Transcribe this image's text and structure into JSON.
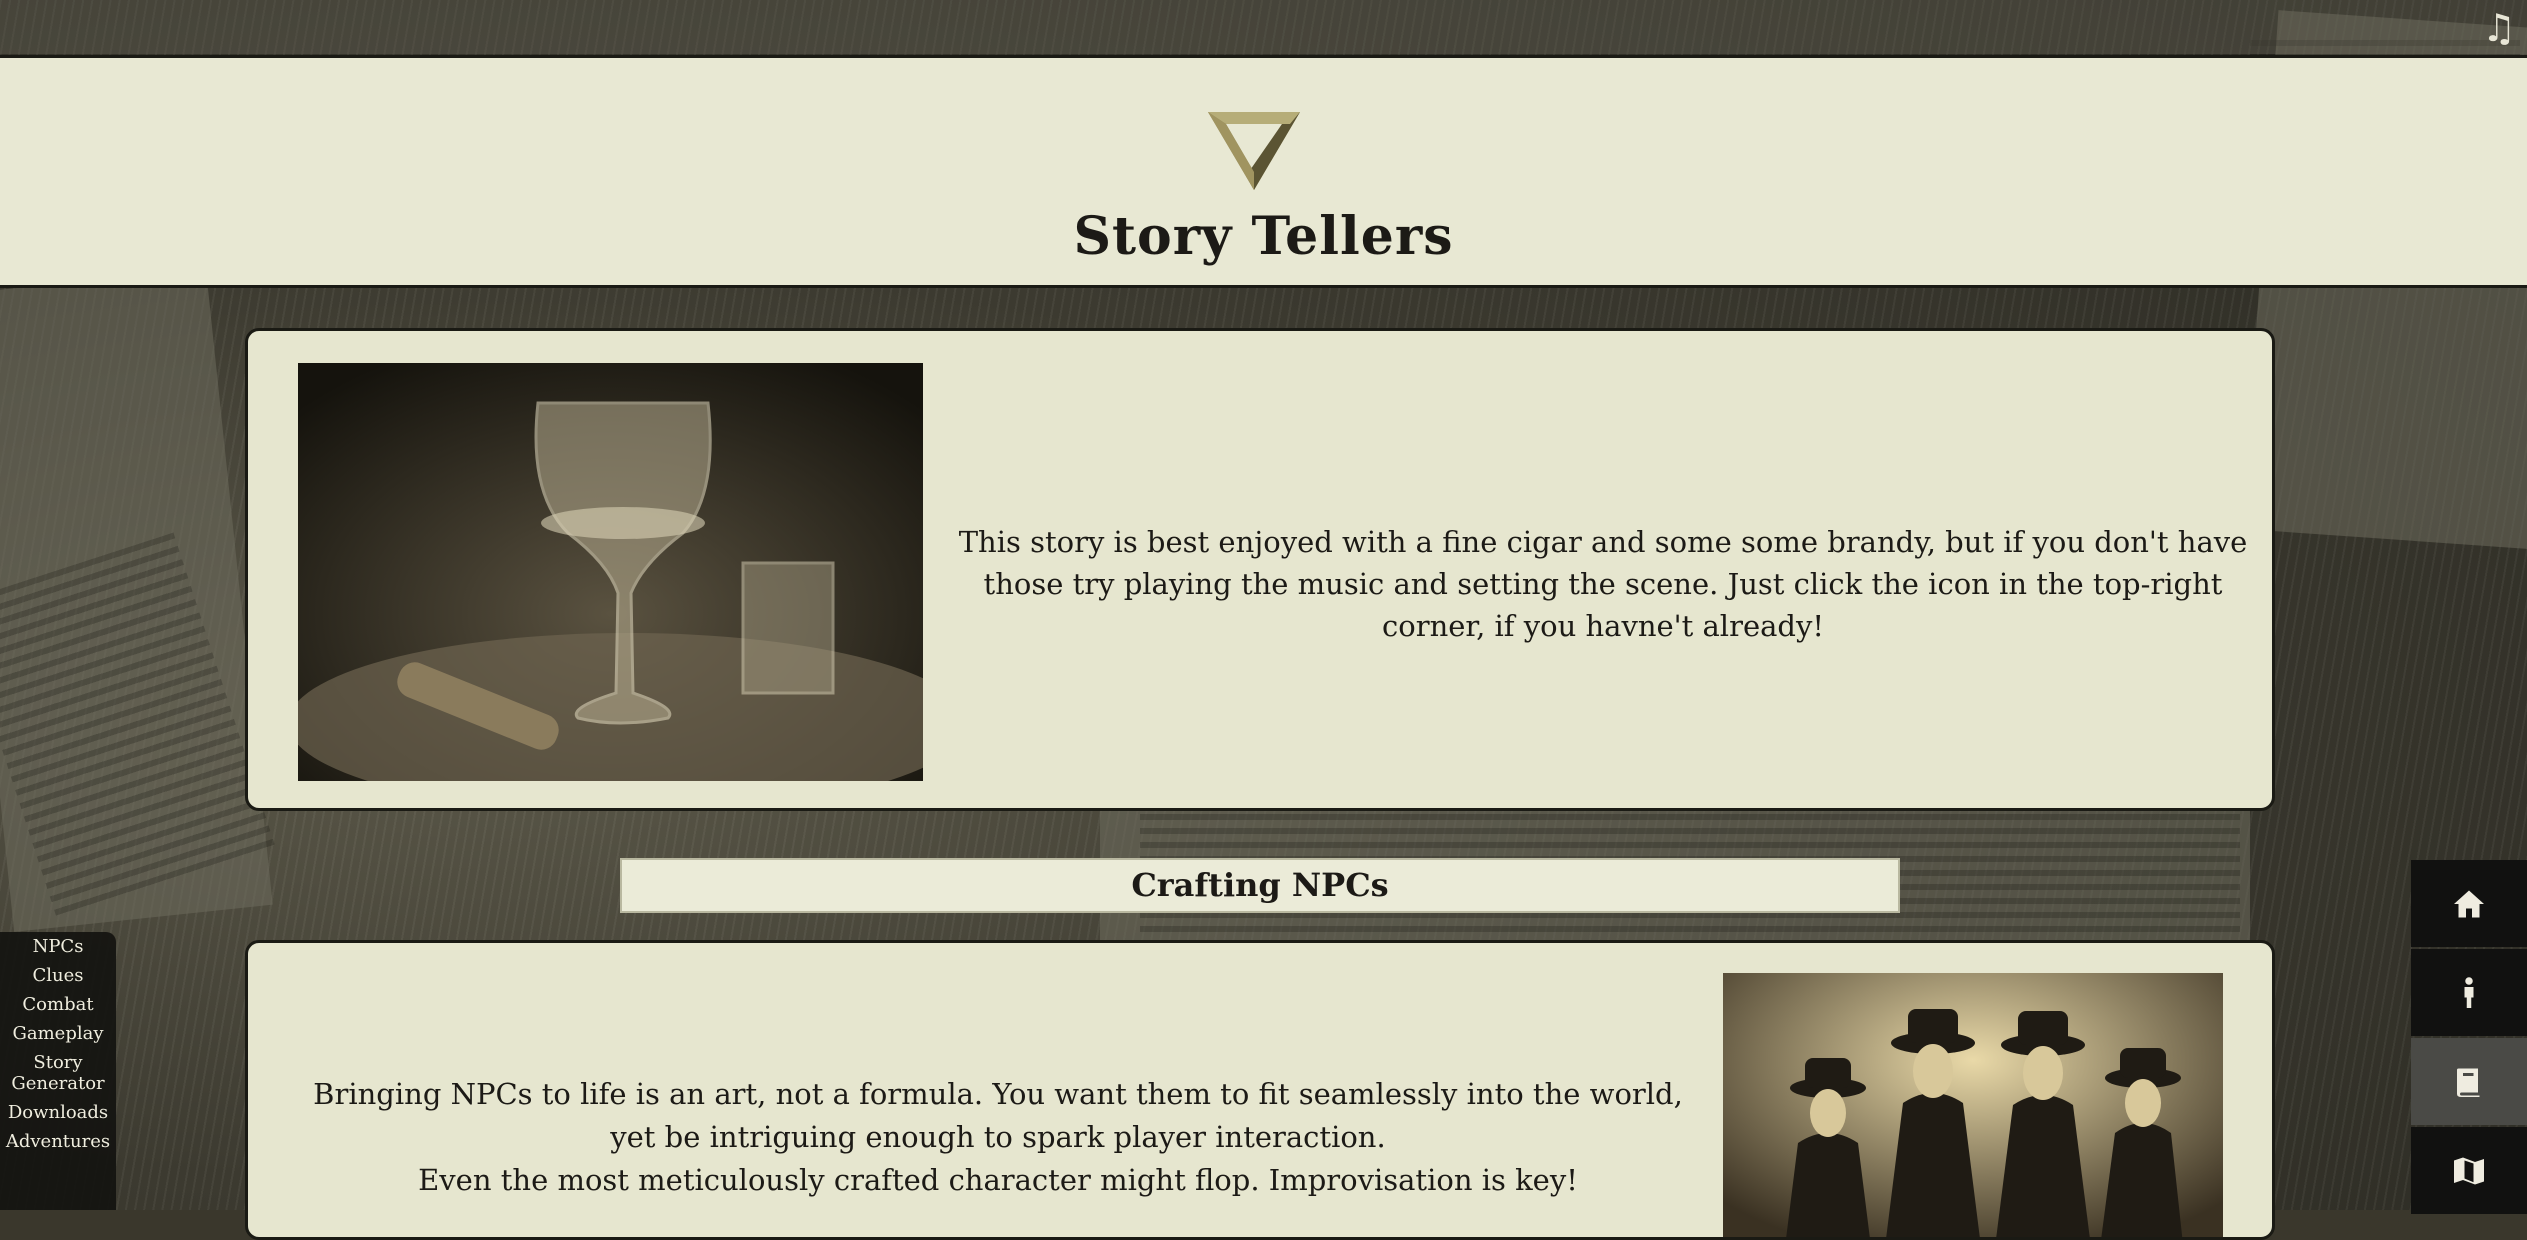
{
  "site": {
    "title": "Story Tellers",
    "music_icon": "music-note-icon"
  },
  "intro": {
    "image_alt": "Brandy glass with cigar",
    "text": "This story is best enjoyed with a fine cigar and some some brandy, but if you don't have those try playing the music and setting the scene. Just click the icon in the top-right corner, if you havne't already!"
  },
  "section": {
    "title": "Crafting NPCs",
    "paragraphs": [
      "Bringing NPCs to life is an art, not a formula. You want them to fit seamlessly into the world, yet be intriguing enough to spark player interaction.",
      "Even the most meticulously crafted character might flop. Improvisation is key!"
    ],
    "image_alt": "Four men in fedoras"
  },
  "left_nav": {
    "items": [
      "NPCs",
      "Clues",
      "Combat",
      "Gameplay",
      "Story Generator",
      "Downloads",
      "Adventures"
    ]
  },
  "right_nav": {
    "items": [
      {
        "icon": "home-icon",
        "active": false
      },
      {
        "icon": "person-icon",
        "active": false
      },
      {
        "icon": "book-icon",
        "active": true
      },
      {
        "icon": "map-icon",
        "active": false
      }
    ]
  },
  "colors": {
    "header_bg": "#e8e8d3",
    "card_bg": "#e6e6cf",
    "text": "#1c1a16",
    "nav_bg": "#111110",
    "nav_active": "#4a4a46",
    "logo_gold": "#8a8050"
  }
}
